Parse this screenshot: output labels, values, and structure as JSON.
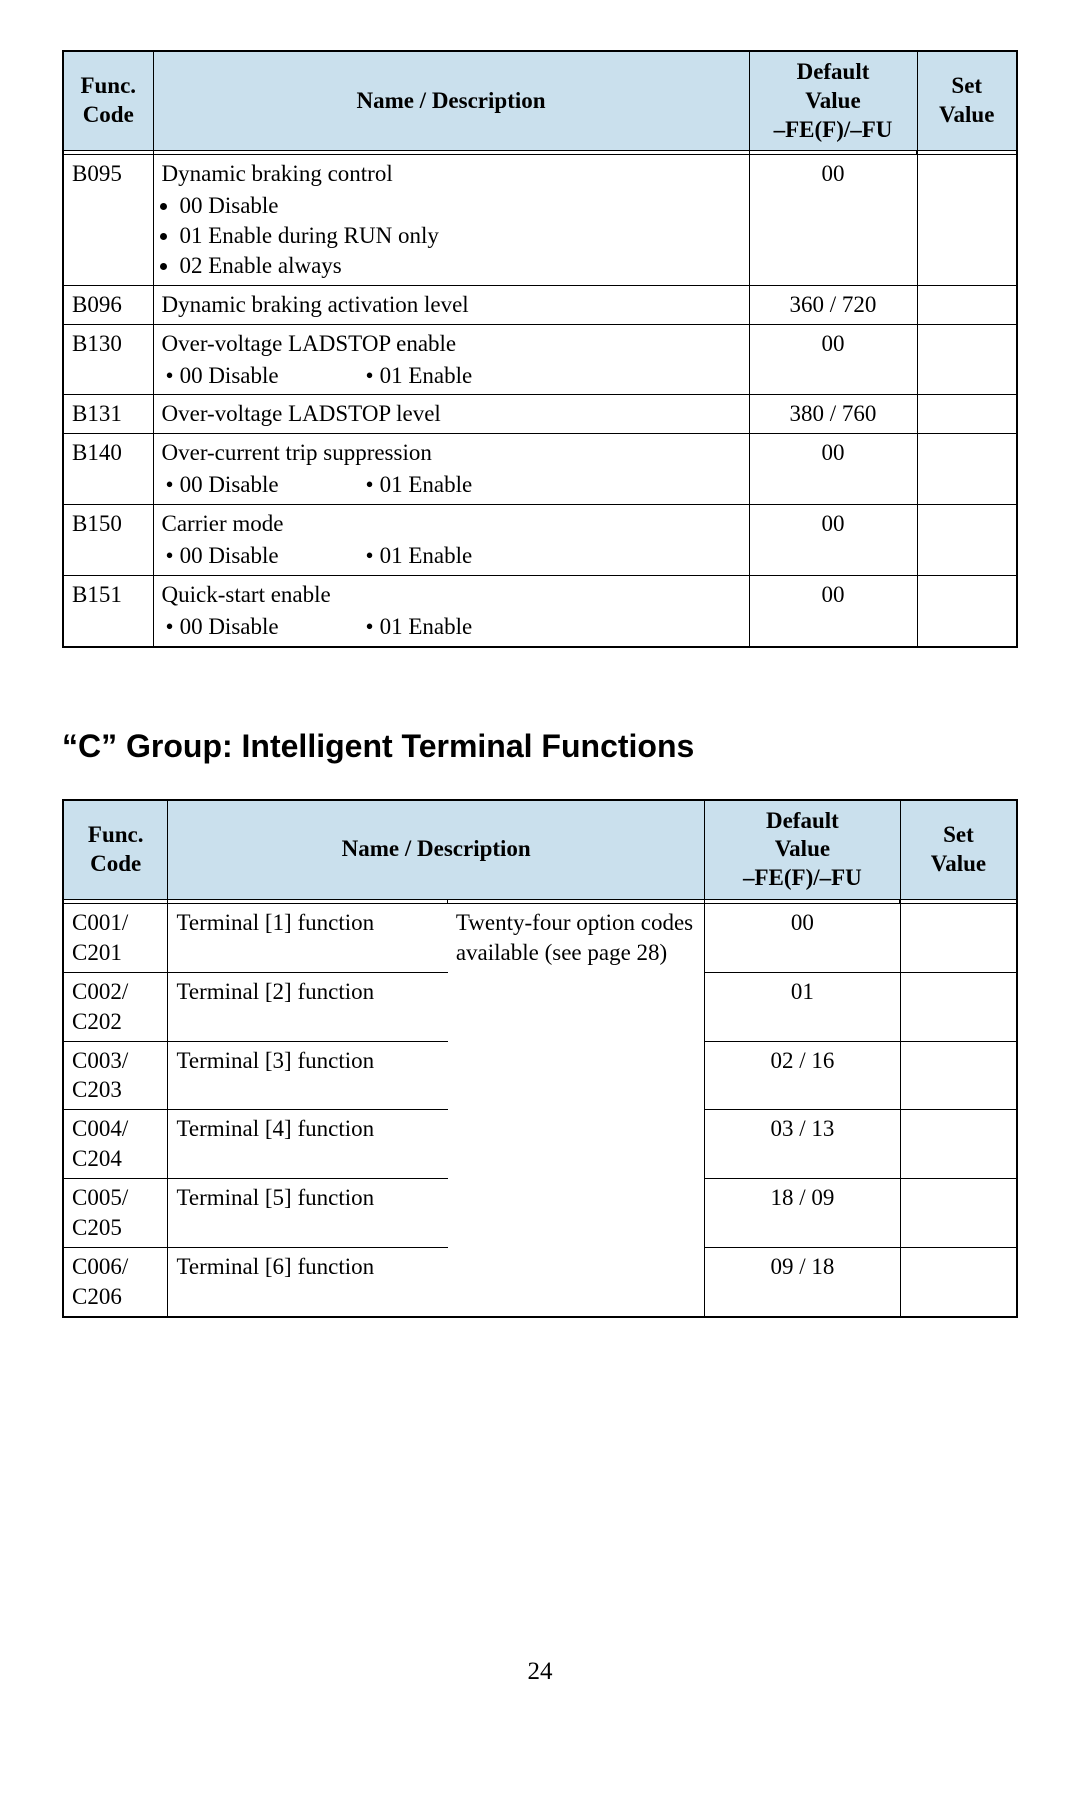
{
  "headers": {
    "func_code_l1": "Func.",
    "func_code_l2": "Code",
    "name_desc": "Name / Description",
    "default_l1": "Default",
    "default_l2": "Value",
    "default_l3": "–FE(F)/–FU",
    "set_l1": "Set",
    "set_l2": "Value"
  },
  "table1": [
    {
      "code": "B095",
      "name": "Dynamic braking control",
      "bullets": [
        "00 Disable",
        "01 Enable during RUN only",
        "02 Enable always"
      ],
      "inline": false,
      "default": "00"
    },
    {
      "code": "B096",
      "name": "Dynamic braking activation level",
      "bullets": [],
      "inline": false,
      "default": "360 / 720"
    },
    {
      "code": "B130",
      "name": "Over-voltage LADSTOP enable",
      "bullets": [
        "00 Disable",
        "01 Enable"
      ],
      "inline": true,
      "default": "00"
    },
    {
      "code": "B131",
      "name": "Over-voltage LADSTOP level",
      "bullets": [],
      "inline": false,
      "default": "380 / 760"
    },
    {
      "code": "B140",
      "name": "Over-current trip suppression",
      "bullets": [
        "00 Disable",
        "01 Enable"
      ],
      "inline": true,
      "default": "00"
    },
    {
      "code": "B150",
      "name": "Carrier mode",
      "bullets": [
        "00 Disable",
        "01 Enable"
      ],
      "inline": true,
      "default": "00"
    },
    {
      "code": "B151",
      "name": "Quick-start enable",
      "bullets": [
        "00 Disable",
        "01 Enable"
      ],
      "inline": true,
      "default": "00"
    }
  ],
  "section_title": "“C” Group: Intelligent Terminal Functions",
  "table2_note": "Twenty-four option codes available (see page 28)",
  "table2": [
    {
      "code": "C001/ C201",
      "name": "Terminal [1] function",
      "default": "00"
    },
    {
      "code": "C002/ C202",
      "name": "Terminal [2] function",
      "default": "01"
    },
    {
      "code": "C003/ C203",
      "name": "Terminal [3] function",
      "default": "02 / 16"
    },
    {
      "code": "C004/ C204",
      "name": "Terminal [4] function",
      "default": "03 / 13"
    },
    {
      "code": "C005/ C205",
      "name": "Terminal [5] function",
      "default": "18 / 09"
    },
    {
      "code": "C006/ C206",
      "name": "Terminal [6] function",
      "default": "09 / 18"
    }
  ],
  "page_number": "24"
}
